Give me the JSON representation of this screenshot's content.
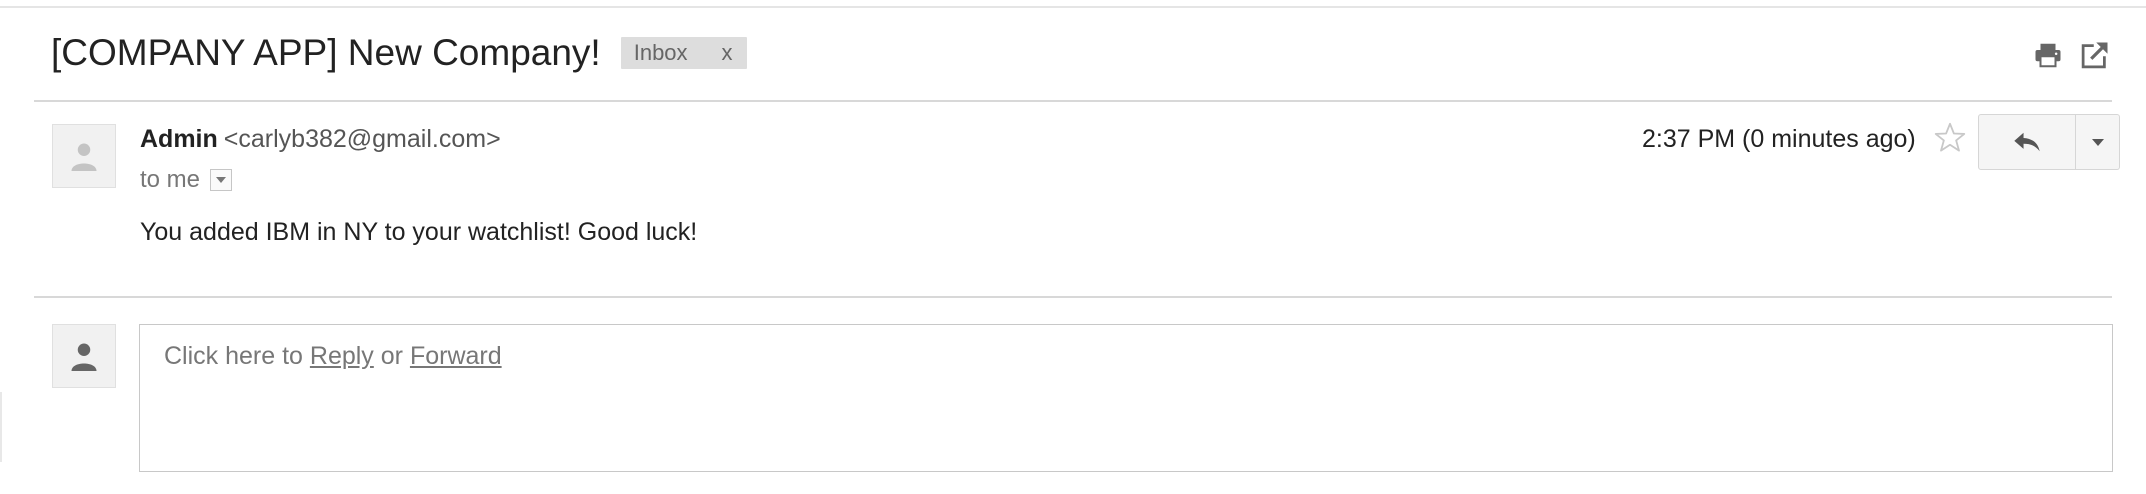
{
  "subject": "[COMPANY APP] New Company!",
  "labels": [
    {
      "name": "Inbox",
      "remove": "x"
    }
  ],
  "toolbar_icons": {
    "print": "print-icon",
    "popout": "open-in-new-window-icon"
  },
  "message": {
    "sender_name": "Admin",
    "sender_email": "<carlyb382@gmail.com>",
    "to": "to me",
    "timestamp": "2:37 PM (0 minutes ago)",
    "body": "You added IBM in NY to your watchlist! Good luck!",
    "starred": false
  },
  "reply_box": {
    "prefix": "Click here to ",
    "reply": "Reply",
    "middle": " or ",
    "forward": "Forward"
  },
  "colors": {
    "label_bg": "#dddddd",
    "avatar_bg": "#f1f1f1",
    "button_bg": "#f5f5f5",
    "divider": "#d8d8d8"
  }
}
